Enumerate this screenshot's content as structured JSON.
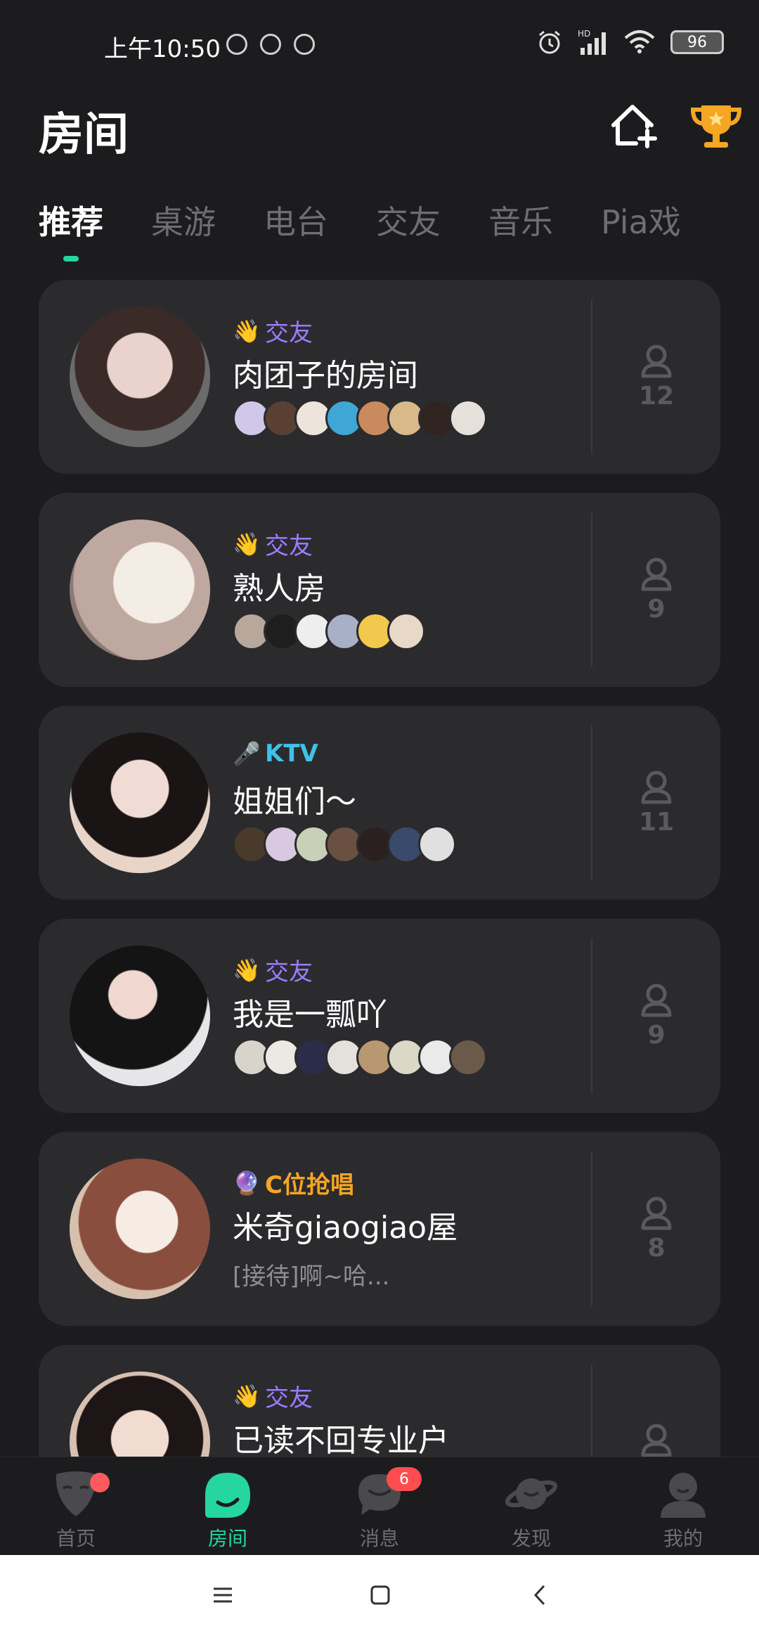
{
  "status_bar": {
    "time": "上午10:50",
    "battery": "96",
    "network": "HD"
  },
  "header": {
    "title": "房间",
    "create_icon": "home-plus-icon",
    "trophy_icon": "trophy-icon"
  },
  "tabs": [
    "推荐",
    "桌游",
    "电台",
    "交友",
    "音乐",
    "Pia戏"
  ],
  "active_tab": 0,
  "colors": {
    "accent": "#25d6a1",
    "tag_friend": "#9b7bff",
    "tag_ktv": "#3fc2e6",
    "tag_c": "#f5a623",
    "card": "#2b2b2e",
    "background": "#1c1c1e"
  },
  "rooms": [
    {
      "tag": "交友",
      "tag_icon": "👋",
      "tag_type": "friend",
      "name": "肉团子的房间",
      "count": "12",
      "members": 8,
      "preview": ""
    },
    {
      "tag": "交友",
      "tag_icon": "👋",
      "tag_type": "friend",
      "name": "熟人房",
      "count": "9",
      "members": 6,
      "preview": ""
    },
    {
      "tag": "KTV",
      "tag_icon": "🎤",
      "tag_type": "ktv",
      "name": "姐姐们～",
      "count": "11",
      "members": 7,
      "preview": ""
    },
    {
      "tag": "交友",
      "tag_icon": "👋",
      "tag_type": "friend",
      "name": "我是一瓢吖",
      "count": "9",
      "members": 8,
      "preview": ""
    },
    {
      "tag": "C位抢唱",
      "tag_icon": "🔮",
      "tag_type": "c",
      "name": "米奇giaogiao屋",
      "count": "8",
      "members": 0,
      "preview": "[接待]啊~哈..."
    },
    {
      "tag": "交友",
      "tag_icon": "👋",
      "tag_type": "friend",
      "name": "已读不回专业户",
      "count": "",
      "members": 0,
      "preview": ""
    }
  ],
  "bottom_nav": [
    {
      "label": "首页",
      "icon": "mask-icon",
      "badge": ""
    },
    {
      "label": "房间",
      "icon": "room-icon",
      "badge": ""
    },
    {
      "label": "消息",
      "icon": "message-icon",
      "badge": "6"
    },
    {
      "label": "发现",
      "icon": "planet-icon",
      "badge": ""
    },
    {
      "label": "我的",
      "icon": "profile-icon",
      "badge": ""
    }
  ]
}
